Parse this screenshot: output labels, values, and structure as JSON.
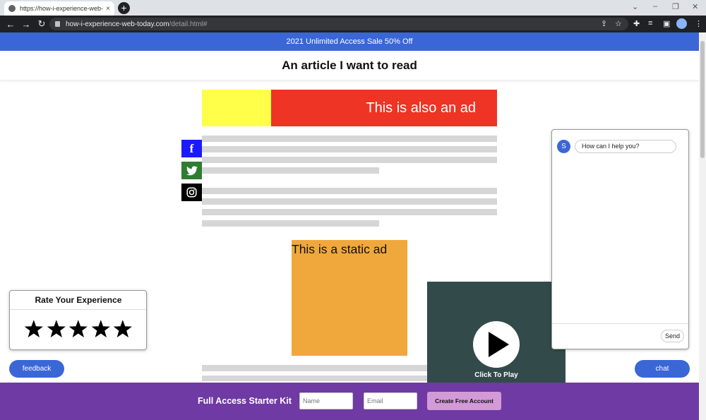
{
  "browser": {
    "tab_title": "https://how-i-experience-web-to",
    "tab_close": "×",
    "new_tab": "+",
    "url_host": "how-i-experience-web-today.com",
    "url_path": "/detail.html#",
    "icons": [
      "back-icon",
      "forward-icon",
      "reload-icon",
      "lock-icon",
      "share-icon",
      "star-icon",
      "extensions-icon",
      "media-icon",
      "sidepanel-icon",
      "profile-avatar",
      "menu-icon"
    ]
  },
  "page": {
    "sale_banner": "2021 Unlimited Access Sale 50% Off",
    "article_title": "An article I want to read",
    "top_ad_text": "This is also an ad",
    "static_ad_text": "This is a static ad",
    "video_label": "Click To Play",
    "social": [
      "facebook-icon",
      "twitter-icon",
      "instagram-icon"
    ]
  },
  "rating": {
    "title": "Rate Your Experience",
    "stars": 5
  },
  "feedback": {
    "label": "feedback"
  },
  "chat": {
    "avatar_letter": "S",
    "message": "How can I help you?",
    "send_label": "Send",
    "open_label": "chat"
  },
  "footer": {
    "title": "Full Access Starter Kit",
    "name_placeholder": "Name",
    "email_placeholder": "Email",
    "create_label": "Create Free Account"
  },
  "colors": {
    "accent_blue": "#3a66d6",
    "footer_purple": "#6f3aa3",
    "ad_red": "#ee3424",
    "ad_yellow": "#ffff4a",
    "static_ad_orange": "#f0a83d",
    "video_bg": "#334a4b"
  }
}
